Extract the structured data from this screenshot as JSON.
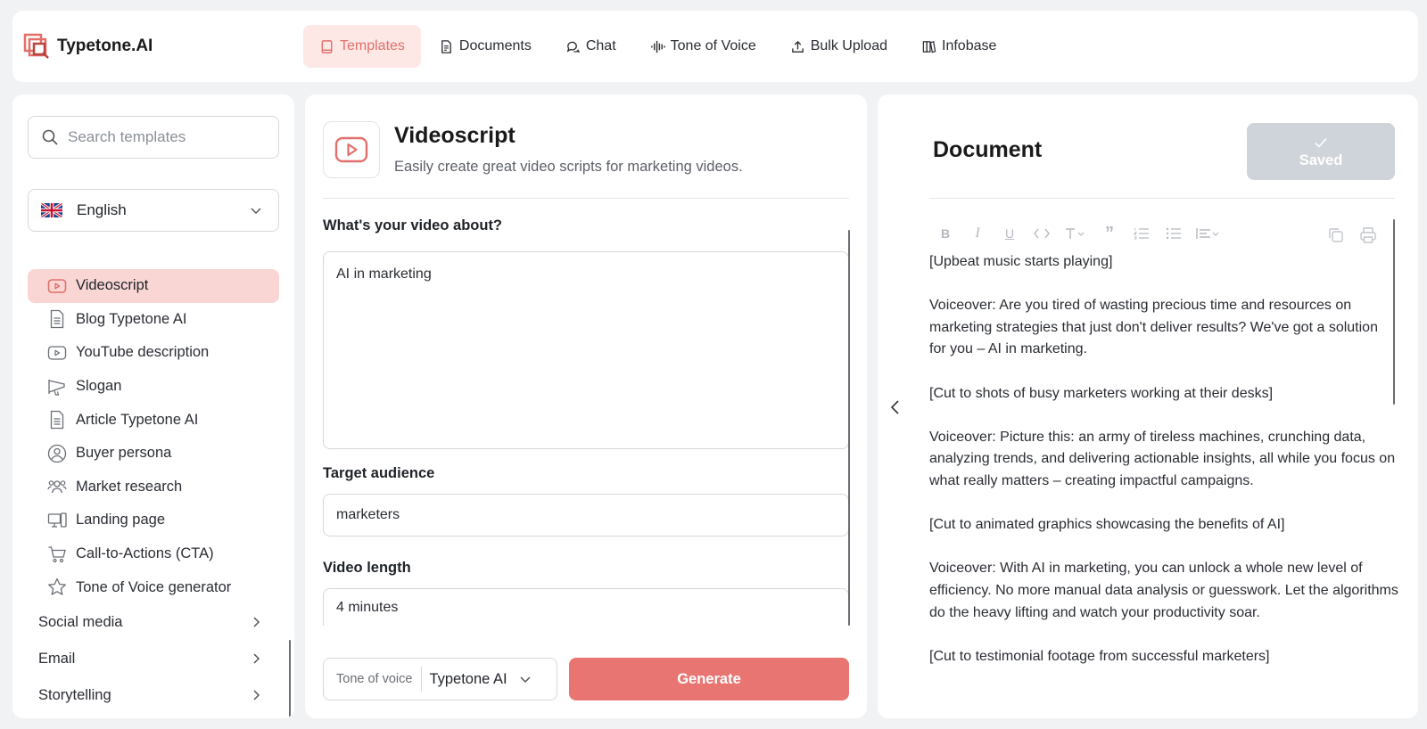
{
  "app": {
    "name": "Typetone.AI",
    "accent_color": "#e36f6a"
  },
  "nav": {
    "items": [
      {
        "label": "Templates",
        "icon": "template-icon",
        "active": true
      },
      {
        "label": "Documents",
        "icon": "document-icon"
      },
      {
        "label": "Chat",
        "icon": "chat-icon"
      },
      {
        "label": "Tone of Voice",
        "icon": "waveform-icon"
      },
      {
        "label": "Bulk Upload",
        "icon": "upload-icon"
      },
      {
        "label": "Infobase",
        "icon": "books-icon"
      }
    ]
  },
  "sidebar": {
    "search_placeholder": "Search templates",
    "language": "English",
    "templates": [
      {
        "label": "Videoscript",
        "icon": "play-icon",
        "active": true
      },
      {
        "label": "Blog Typetone AI",
        "icon": "file-text-icon"
      },
      {
        "label": "YouTube description",
        "icon": "play-icon"
      },
      {
        "label": "Slogan",
        "icon": "megaphone-icon"
      },
      {
        "label": "Article Typetone AI",
        "icon": "file-text-icon"
      },
      {
        "label": "Buyer persona",
        "icon": "user-circle-icon"
      },
      {
        "label": "Market research",
        "icon": "users-icon"
      },
      {
        "label": "Landing page",
        "icon": "devices-icon"
      },
      {
        "label": "Call-to-Actions (CTA)",
        "icon": "cart-icon"
      },
      {
        "label": "Tone of Voice generator",
        "icon": "star-icon"
      }
    ],
    "categories": [
      {
        "label": "Social media"
      },
      {
        "label": "Email"
      },
      {
        "label": "Storytelling"
      }
    ]
  },
  "template": {
    "title": "Videoscript",
    "description": "Easily create great video scripts for marketing videos.",
    "fields": {
      "about_label": "What's your video about?",
      "about_value": "AI in marketing",
      "audience_label": "Target audience",
      "audience_value": "marketers",
      "length_label": "Video length",
      "length_value": "4 minutes"
    },
    "tone_label": "Tone of voice",
    "tone_value": "Typetone AI",
    "generate_label": "Generate"
  },
  "document": {
    "title": "Document",
    "saved_label": "Saved",
    "paragraphs": [
      "[Upbeat music starts playing]",
      "Voiceover: Are you tired of wasting precious time and resources on marketing strategies that just don't deliver results? We've got a solution for you – AI in marketing.",
      "[Cut to shots of busy marketers working at their desks]",
      "Voiceover: Picture this: an army of tireless machines, crunching data, analyzing trends, and delivering actionable insights, all while you focus on what really matters – creating impactful campaigns.",
      "[Cut to animated graphics showcasing the benefits of AI]",
      "Voiceover: With AI in marketing, you can unlock a whole new level of efficiency. No more manual data analysis or guesswork. Let the algorithms do the heavy lifting and watch your productivity soar.",
      "[Cut to testimonial footage from successful marketers]"
    ]
  }
}
